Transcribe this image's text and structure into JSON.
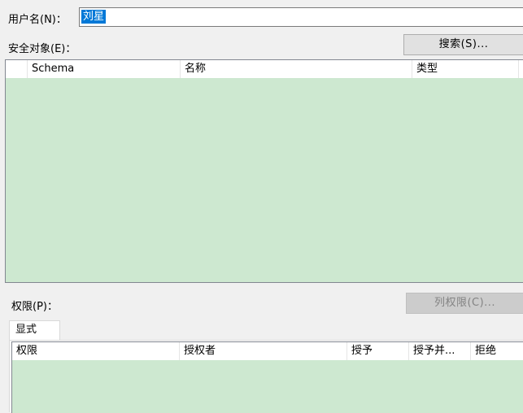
{
  "user": {
    "label": "用户名(N)：",
    "value": "刘星"
  },
  "securables": {
    "label": "安全对象(E)：",
    "search_button": "搜索(S)...",
    "columns": [
      "",
      "Schema",
      "名称",
      "类型"
    ],
    "rows": []
  },
  "permissions": {
    "label": "权限(P)：",
    "column_perm_button": "列权限(C)...",
    "tab": "显式",
    "columns": [
      "权限",
      "授权者",
      "授予",
      "授予并...",
      "拒绝"
    ],
    "rows": []
  },
  "colors": {
    "grid_background": "#cde8d0",
    "selection": "#0078d7"
  }
}
